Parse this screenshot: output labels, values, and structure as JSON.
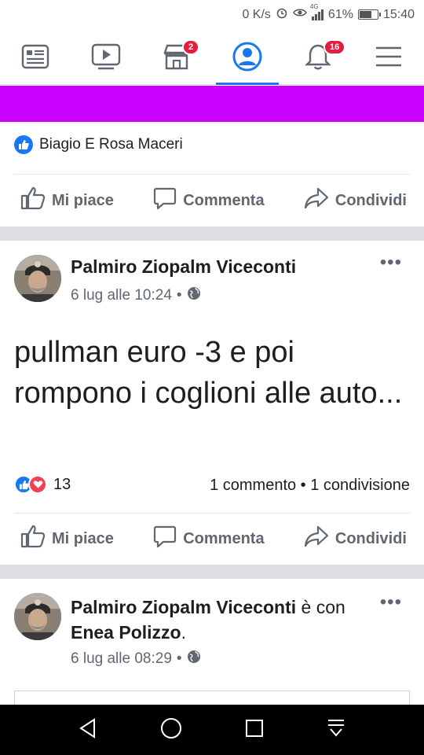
{
  "status_bar": {
    "net_speed": "0 K/s",
    "network": "4G",
    "battery": "61%",
    "battery_level": 0.61,
    "time": "15:40"
  },
  "top_nav": {
    "items": [
      {
        "icon": "news-feed-icon"
      },
      {
        "icon": "watch-icon"
      },
      {
        "icon": "marketplace-icon",
        "badge": "2"
      },
      {
        "icon": "profile-icon",
        "active": true
      },
      {
        "icon": "notifications-icon",
        "badge": "16"
      },
      {
        "icon": "menu-icon"
      }
    ]
  },
  "liked_by": "Biagio E Rosa Maceri",
  "actions": {
    "like": "Mi piace",
    "comment": "Commenta",
    "share": "Condividi"
  },
  "post1": {
    "author": "Palmiro Ziopalm Viceconti",
    "date": "6 lug alle 10:24",
    "privacy_sep": "•",
    "text": "pullman euro -3 e poi rompono i coglioni alle auto...",
    "reaction_count": "13",
    "stats": "1 commento • 1 condivisione"
  },
  "post2": {
    "author": "Palmiro Ziopalm Viceconti",
    "with_word": "è con",
    "tagged": "Enea Polizzo",
    "period": ".",
    "date": "6 lug alle 08:29",
    "privacy_sep": "•"
  },
  "colors": {
    "accent": "#1877f2",
    "band": "#cc00ff",
    "badge": "#e41e3f"
  }
}
